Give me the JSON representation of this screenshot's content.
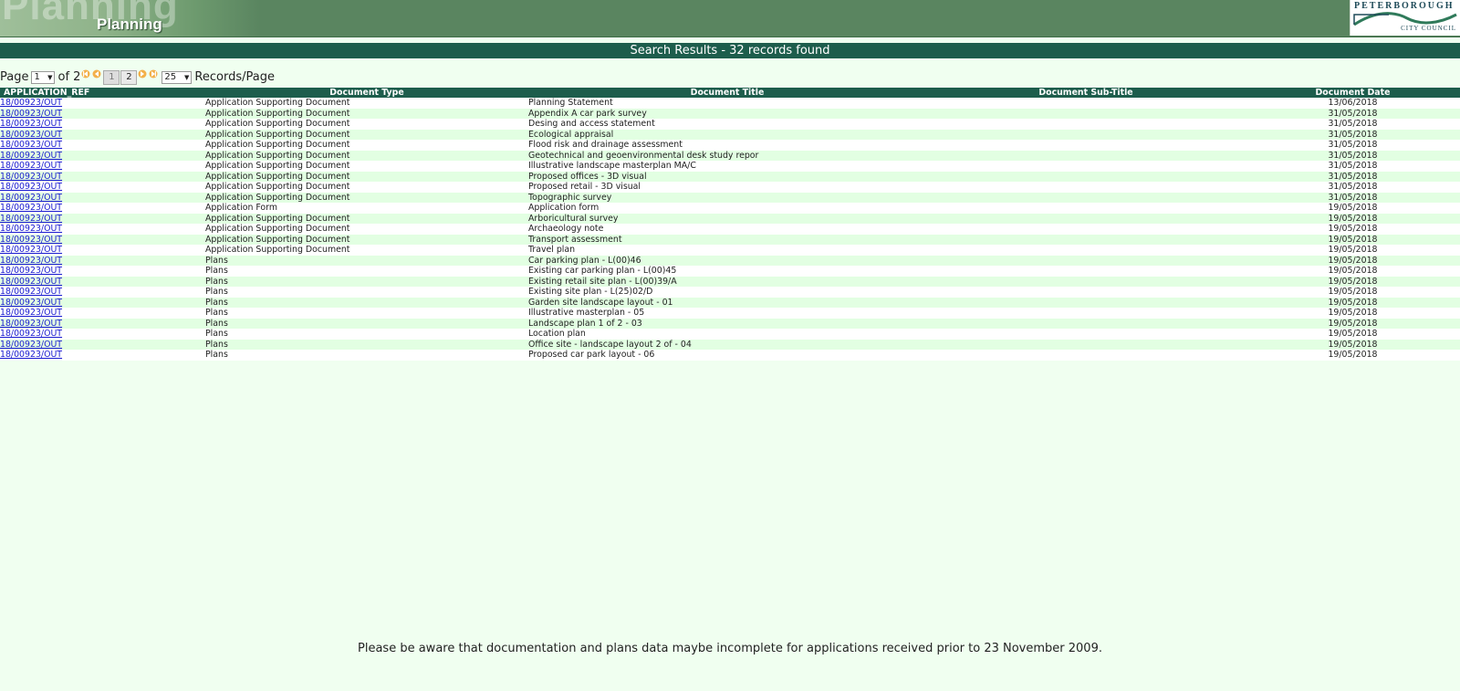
{
  "header": {
    "watermark": "Planning",
    "title": "Planning",
    "logo_top": "PETERBOROUGH",
    "logo_bottom": "CITY COUNCIL"
  },
  "results_bar": "Search Results - 32 records found",
  "pager": {
    "page_label": "Page",
    "page_value": "1",
    "of_label": "of 2",
    "page_buttons": [
      "1",
      "2"
    ],
    "per_page_value": "25",
    "per_page_label": "Records/Page"
  },
  "columns": [
    "APPLICATION_REF",
    "Document Type",
    "Document Title",
    "Document Sub-Title",
    "Document Date"
  ],
  "rows": [
    {
      "ref": "18/00923/OUT",
      "type": "Application Supporting Document",
      "title": "Planning Statement",
      "subtitle": "",
      "date": "13/06/2018"
    },
    {
      "ref": "18/00923/OUT",
      "type": "Application Supporting Document",
      "title": "Appendix A car park survey",
      "subtitle": "",
      "date": "31/05/2018"
    },
    {
      "ref": "18/00923/OUT",
      "type": "Application Supporting Document",
      "title": "Desing and access statement",
      "subtitle": "",
      "date": "31/05/2018"
    },
    {
      "ref": "18/00923/OUT",
      "type": "Application Supporting Document",
      "title": "Ecological appraisal",
      "subtitle": "",
      "date": "31/05/2018"
    },
    {
      "ref": "18/00923/OUT",
      "type": "Application Supporting Document",
      "title": "Flood risk and drainage assessment",
      "subtitle": "",
      "date": "31/05/2018"
    },
    {
      "ref": "18/00923/OUT",
      "type": "Application Supporting Document",
      "title": "Geotechnical and geoenvironmental desk study repor",
      "subtitle": "",
      "date": "31/05/2018"
    },
    {
      "ref": "18/00923/OUT",
      "type": "Application Supporting Document",
      "title": "Illustrative landscape masterplan MA/C",
      "subtitle": "",
      "date": "31/05/2018"
    },
    {
      "ref": "18/00923/OUT",
      "type": "Application Supporting Document",
      "title": "Proposed offices - 3D visual",
      "subtitle": "",
      "date": "31/05/2018"
    },
    {
      "ref": "18/00923/OUT",
      "type": "Application Supporting Document",
      "title": "Proposed retail - 3D visual",
      "subtitle": "",
      "date": "31/05/2018"
    },
    {
      "ref": "18/00923/OUT",
      "type": "Application Supporting Document",
      "title": "Topographic survey",
      "subtitle": "",
      "date": "31/05/2018"
    },
    {
      "ref": "18/00923/OUT",
      "type": "Application Form",
      "title": "Application form",
      "subtitle": "",
      "date": "19/05/2018"
    },
    {
      "ref": "18/00923/OUT",
      "type": "Application Supporting Document",
      "title": "Arboricultural survey",
      "subtitle": "",
      "date": "19/05/2018"
    },
    {
      "ref": "18/00923/OUT",
      "type": "Application Supporting Document",
      "title": "Archaeology note",
      "subtitle": "",
      "date": "19/05/2018"
    },
    {
      "ref": "18/00923/OUT",
      "type": "Application Supporting Document",
      "title": "Transport assessment",
      "subtitle": "",
      "date": "19/05/2018"
    },
    {
      "ref": "18/00923/OUT",
      "type": "Application Supporting Document",
      "title": "Travel plan",
      "subtitle": "",
      "date": "19/05/2018"
    },
    {
      "ref": "18/00923/OUT",
      "type": "Plans",
      "title": "Car parking plan - L(00)46",
      "subtitle": "",
      "date": "19/05/2018"
    },
    {
      "ref": "18/00923/OUT",
      "type": "Plans",
      "title": "Existing car parking plan - L(00)45",
      "subtitle": "",
      "date": "19/05/2018"
    },
    {
      "ref": "18/00923/OUT",
      "type": "Plans",
      "title": "Existing retail site plan - L(00)39/A",
      "subtitle": "",
      "date": "19/05/2018"
    },
    {
      "ref": "18/00923/OUT",
      "type": "Plans",
      "title": "Existing site plan - L(25)02/D",
      "subtitle": "",
      "date": "19/05/2018"
    },
    {
      "ref": "18/00923/OUT",
      "type": "Plans",
      "title": "Garden site landscape layout - 01",
      "subtitle": "",
      "date": "19/05/2018"
    },
    {
      "ref": "18/00923/OUT",
      "type": "Plans",
      "title": "Illustrative masterplan - 05",
      "subtitle": "",
      "date": "19/05/2018"
    },
    {
      "ref": "18/00923/OUT",
      "type": "Plans",
      "title": "Landscape plan 1 of 2 - 03",
      "subtitle": "",
      "date": "19/05/2018"
    },
    {
      "ref": "18/00923/OUT",
      "type": "Plans",
      "title": "Location plan",
      "subtitle": "",
      "date": "19/05/2018"
    },
    {
      "ref": "18/00923/OUT",
      "type": "Plans",
      "title": "Office site - landscape layout 2 of - 04",
      "subtitle": "",
      "date": "19/05/2018"
    },
    {
      "ref": "18/00923/OUT",
      "type": "Plans",
      "title": "Proposed car park layout - 06",
      "subtitle": "",
      "date": "19/05/2018"
    }
  ],
  "notice": "Please be aware that documentation and plans data maybe incomplete for applications received prior to 23 November 2009.",
  "colors": {
    "banner": "#5a8560",
    "header_bar": "#1d5d4c",
    "page_bg": "#f0fff0",
    "row_alt": "#e2ffe2",
    "link": "#1a1ad0"
  }
}
